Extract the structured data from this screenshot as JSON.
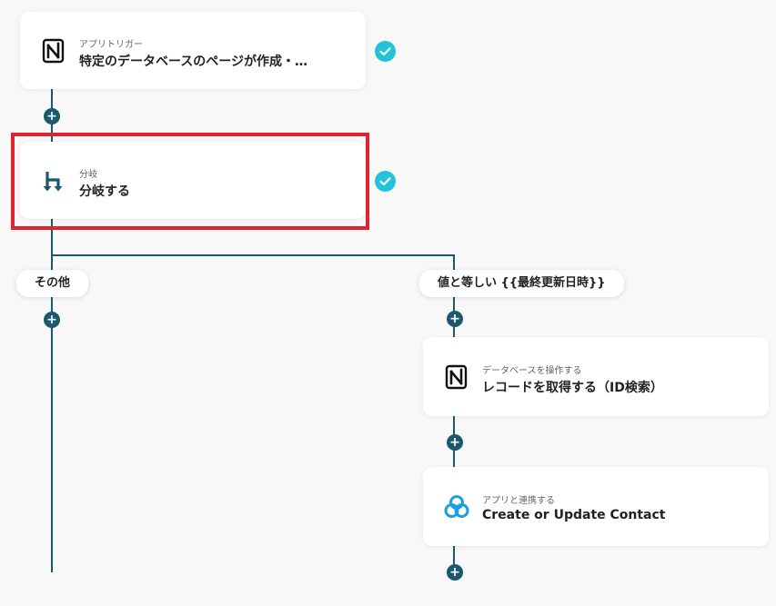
{
  "flow": {
    "trigger": {
      "sublabel": "アプリトリガー",
      "title": "特定のデータベースのページが作成・…",
      "icon": "notion-icon"
    },
    "branch": {
      "sublabel": "分岐",
      "title": "分岐する",
      "icon": "branch-icon"
    },
    "branch_labels": {
      "left": "その他",
      "right": "値と等しい {{最終更新日時}}"
    },
    "notion_step": {
      "sublabel": "データベースを操作する",
      "title": "レコードを取得する（ID検索）",
      "icon": "notion-icon"
    },
    "app_step": {
      "sublabel": "アプリと連携する",
      "title": "Create or Update Contact",
      "icon": "app-link-icon"
    }
  },
  "colors": {
    "line": "#1b5a6e",
    "check": "#22c3d6",
    "highlight": "#e0242f"
  }
}
